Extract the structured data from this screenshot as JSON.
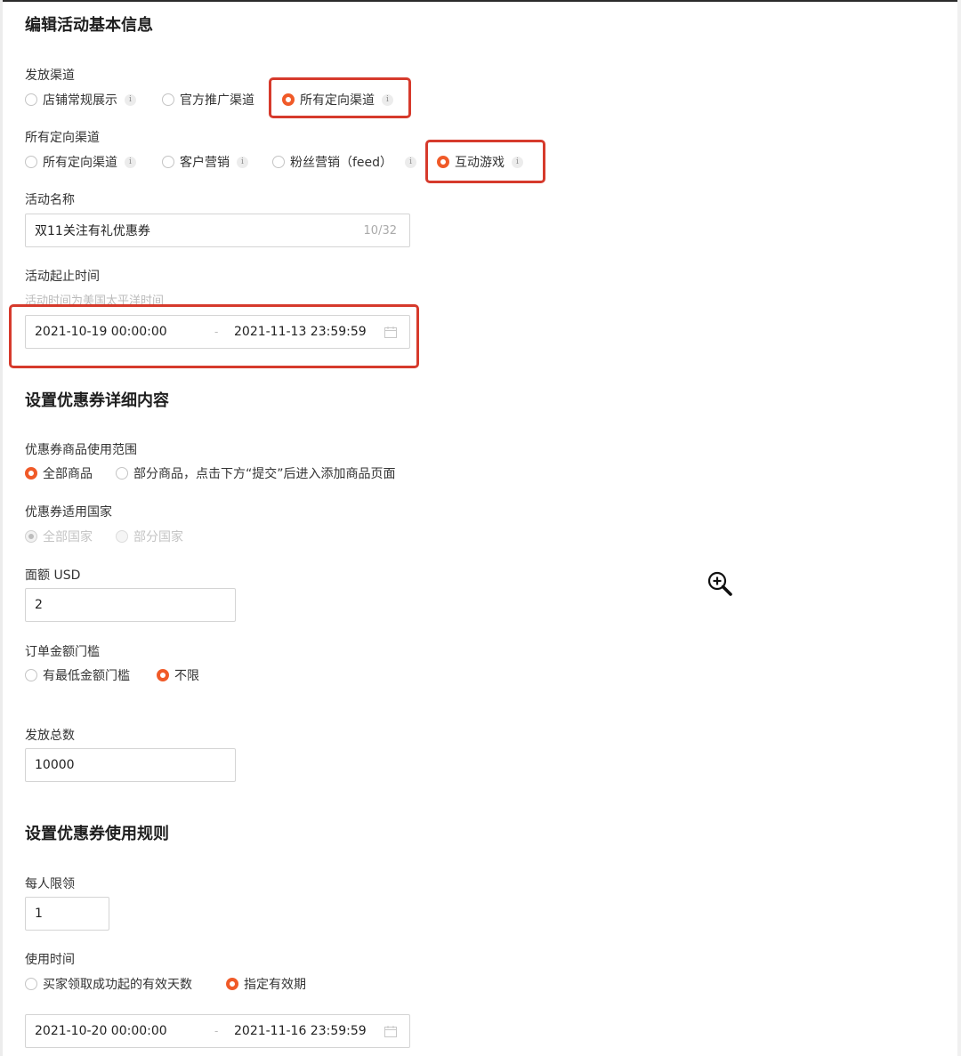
{
  "basic_info": {
    "title": "编辑活动基本信息",
    "channel": {
      "label": "发放渠道",
      "options": [
        "店铺常规展示",
        "官方推广渠道",
        "所有定向渠道"
      ],
      "selected": "所有定向渠道"
    },
    "targeted_channel": {
      "label": "所有定向渠道",
      "options": [
        "所有定向渠道",
        "客户营销",
        "粉丝营销（feed）",
        "互动游戏"
      ],
      "selected": "互动游戏"
    },
    "activity_name": {
      "label": "活动名称",
      "value": "双11关注有礼优惠券",
      "counter": "10/32"
    },
    "activity_time": {
      "label": "活动起止时间",
      "hint": "活动时间为美国太平洋时间",
      "start": "2021-10-19 00:00:00",
      "separator": "-",
      "end": "2021-11-13 23:59:59"
    }
  },
  "coupon_details": {
    "title": "设置优惠券详细内容",
    "scope": {
      "label": "优惠券商品使用范围",
      "options": [
        "全部商品",
        "部分商品，点击下方“提交”后进入添加商品页面"
      ],
      "selected": "全部商品"
    },
    "country": {
      "label": "优惠券适用国家",
      "options": [
        "全部国家",
        "部分国家"
      ],
      "selected": "全部国家",
      "disabled": true
    },
    "face_value": {
      "label": "面额 USD",
      "value": "2"
    },
    "threshold": {
      "label": "订单金额门槛",
      "options": [
        "有最低金额门槛",
        "不限"
      ],
      "selected": "不限"
    },
    "total": {
      "label": "发放总数",
      "value": "10000"
    }
  },
  "usage_rules": {
    "title": "设置优惠券使用规则",
    "per_person": {
      "label": "每人限领",
      "value": "1"
    },
    "usage_time": {
      "label": "使用时间",
      "options": [
        "买家领取成功起的有效天数",
        "指定有效期"
      ],
      "selected": "指定有效期",
      "start": "2021-10-20 00:00:00",
      "separator": "-",
      "end": "2021-11-16 23:59:59"
    }
  },
  "icons": {
    "info": "info-icon",
    "info_glyph": "i",
    "calendar": "calendar-icon",
    "zoom": "zoom-in-icon"
  },
  "colors": {
    "accent": "#f05a28",
    "highlight_box": "#d63a2c",
    "text": "#333333",
    "muted": "#bbbbbb"
  }
}
